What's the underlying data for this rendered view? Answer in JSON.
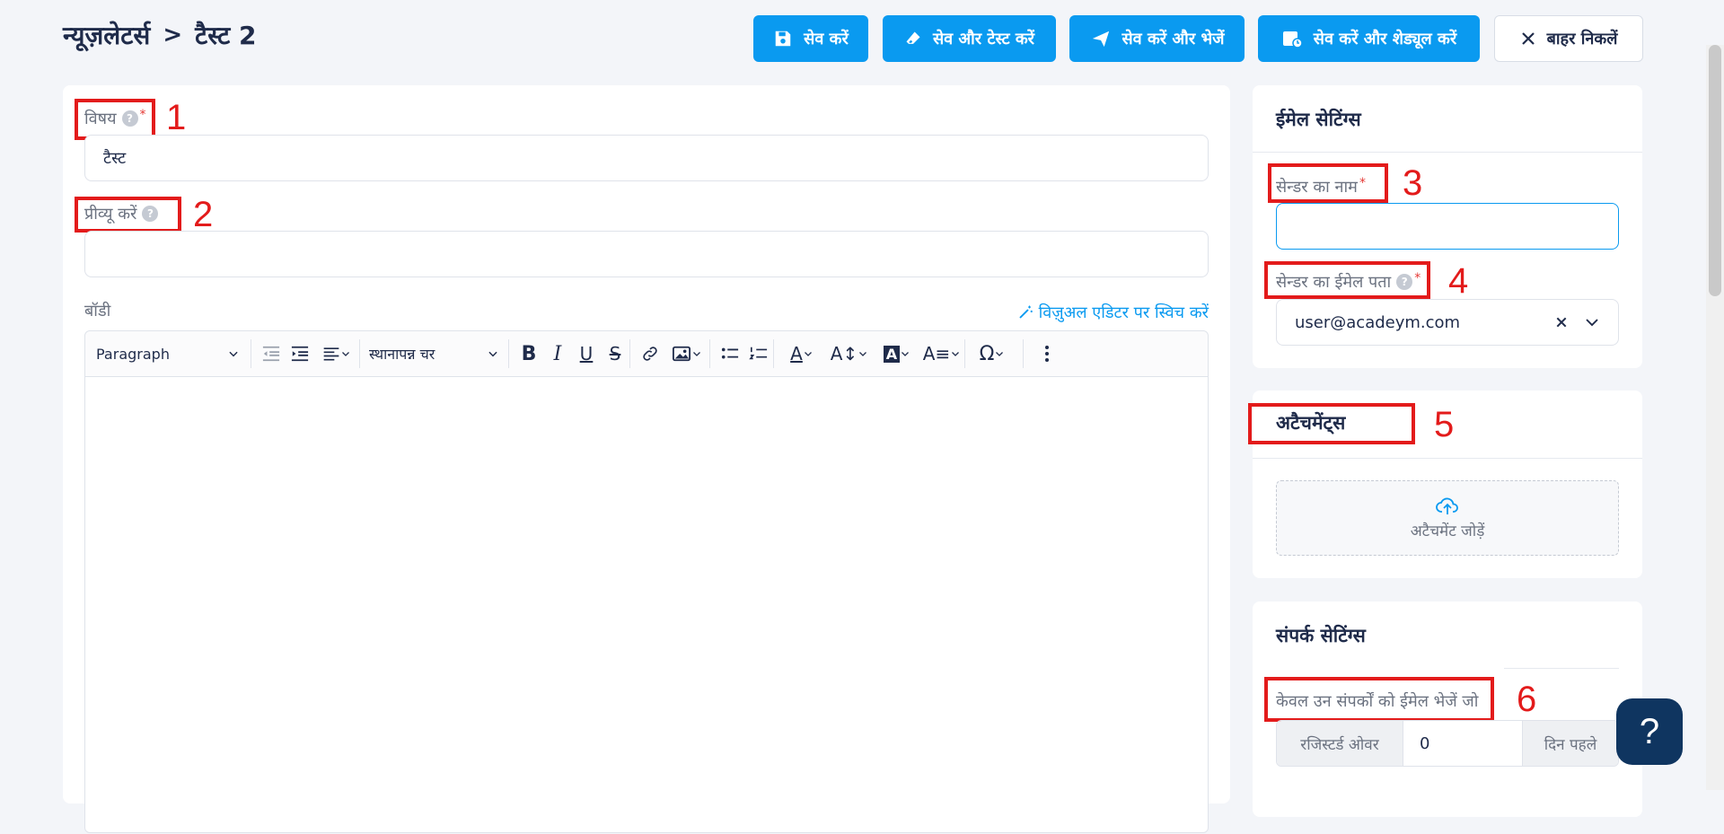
{
  "header": {
    "breadcrumb_root": "न्यूज़लेटर्स",
    "breadcrumb_sep": ">",
    "breadcrumb_current": "टैस्ट 2",
    "buttons": {
      "save": "सेव करें",
      "save_test": "सेव और टेस्ट करें",
      "save_send": "सेव करें और भेजें",
      "save_schedule": "सेव करें और शेड्यूल करें",
      "exit": "बाहर निकलें"
    }
  },
  "form": {
    "subject_label": "विषय",
    "subject_value": "टैस्ट",
    "preview_label": "प्रीव्यू करें",
    "preview_value": "",
    "body_label": "बॉडी",
    "switch_editor": "विज़ुअल एडिटर पर स्विच करें",
    "toolbar": {
      "paragraph": "Paragraph",
      "placeholder_var": "स्थानापन्न चर"
    }
  },
  "email_settings": {
    "title": "ईमेल सेटिंग्स",
    "sender_name_label": "सेन्डर का नाम",
    "sender_name_value": "",
    "sender_email_label": "सेन्डर का ईमेल पता",
    "sender_email_value": "user@acadeym.com"
  },
  "attachments": {
    "title": "अटैचमेंट्स",
    "add_label": "अटैचमेंट जोड़ें"
  },
  "contact_settings": {
    "title": "संपर्क सेटिंग्स",
    "only_send_label": "केवल उन संपर्कों को ईमेल भेजें जो",
    "registered_over": "रजिस्टर्ड ओवर",
    "days_value": "0",
    "days_before": "दिन पहले"
  },
  "annotations": [
    "1",
    "2",
    "3",
    "4",
    "5",
    "6"
  ],
  "help_fab": "?"
}
